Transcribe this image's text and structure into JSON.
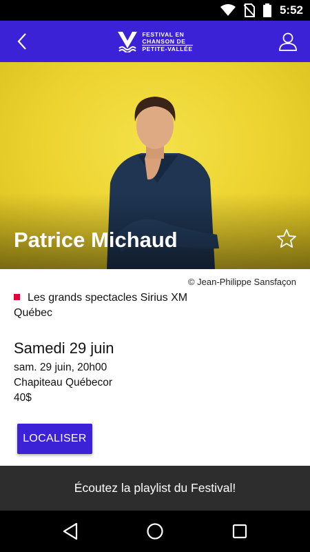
{
  "status_bar": {
    "time": "5:52",
    "icons": [
      "wifi-icon",
      "no-sim-icon",
      "battery-icon"
    ]
  },
  "app_bar": {
    "back_icon": "back-arrow-icon",
    "logo_lines": [
      "FESTIVAL EN",
      "CHANSON DE",
      "PETITE-VALLÉE"
    ],
    "profile_icon": "user-icon"
  },
  "hero": {
    "artist_name": "Patrice Michaud",
    "favorite_icon": "star-outline-icon"
  },
  "event": {
    "photo_credit": "© Jean-Philippe Sansfaçon",
    "category": "Les grands spectacles Sirius XM Québec",
    "category_color": "#e0003c",
    "date_heading": "Samedi 29 juin",
    "datetime": "sam. 29 juin, 20h00",
    "venue": "Chapiteau Québecor",
    "price": "40$",
    "locate_label": "LOCALISER"
  },
  "playlist_banner": "Écoutez la playlist du Festival!",
  "nav_bar": {
    "icons": [
      "nav-back-icon",
      "nav-home-icon",
      "nav-recents-icon"
    ]
  },
  "colors": {
    "primary": "#3b22d6",
    "banner": "#2d2d2d"
  }
}
